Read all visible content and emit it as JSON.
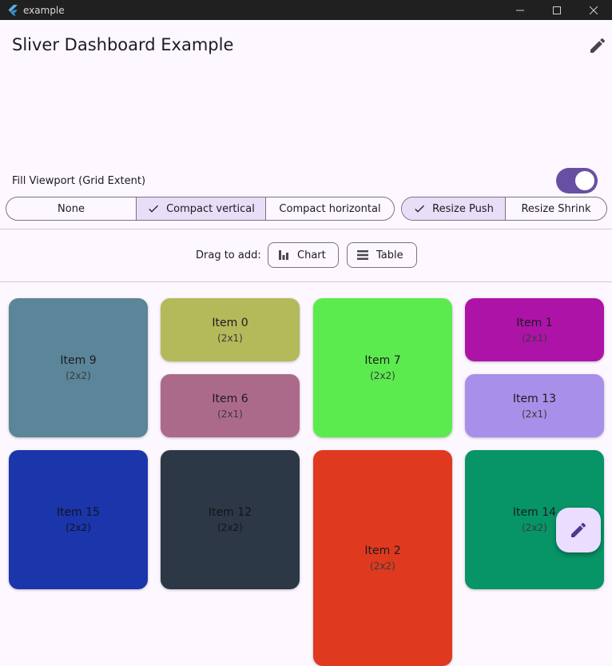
{
  "window": {
    "title": "example"
  },
  "appbar": {
    "title": "Sliver Dashboard Example"
  },
  "fill_viewport": {
    "label": "Fill Viewport (Grid Extent)",
    "enabled": true
  },
  "compaction": {
    "options": [
      {
        "label": "None",
        "selected": false
      },
      {
        "label": "Compact vertical",
        "selected": true
      },
      {
        "label": "Compact horizontal",
        "selected": false
      }
    ]
  },
  "resize": {
    "options": [
      {
        "label": "Resize Push",
        "selected": true
      },
      {
        "label": "Resize Shrink",
        "selected": false
      }
    ]
  },
  "drag": {
    "label": "Drag to add:",
    "chips": [
      {
        "label": "Chart",
        "icon": "bar-chart-icon"
      },
      {
        "label": "Table",
        "icon": "table-rows-icon"
      }
    ]
  },
  "tiles": [
    {
      "title": "Item 9",
      "size": "(2x2)",
      "color": "#5b8599"
    },
    {
      "title": "Item 0",
      "size": "(2x1)",
      "color": "#b4b95a"
    },
    {
      "title": "Item 6",
      "size": "(2x1)",
      "color": "#ac6a8b"
    },
    {
      "title": "Item 7",
      "size": "(2x2)",
      "color": "#5beb4e"
    },
    {
      "title": "Item 1",
      "size": "(2x1)",
      "color": "#ae13a8"
    },
    {
      "title": "Item 13",
      "size": "(2x1)",
      "color": "#a88fe9"
    },
    {
      "title": "Item 15",
      "size": "(2x2)",
      "color": "#1b35ab"
    },
    {
      "title": "Item 12",
      "size": "(2x2)",
      "color": "#2d3846"
    },
    {
      "title": "Item 2",
      "size": "(2x2)",
      "color": "#df3920"
    },
    {
      "title": "Item 14",
      "size": "(2x2)",
      "color": "#079467"
    }
  ],
  "colors": {
    "accent": "#6750a4",
    "selected_segment": "#e8def8",
    "fab": "#eaddff"
  }
}
